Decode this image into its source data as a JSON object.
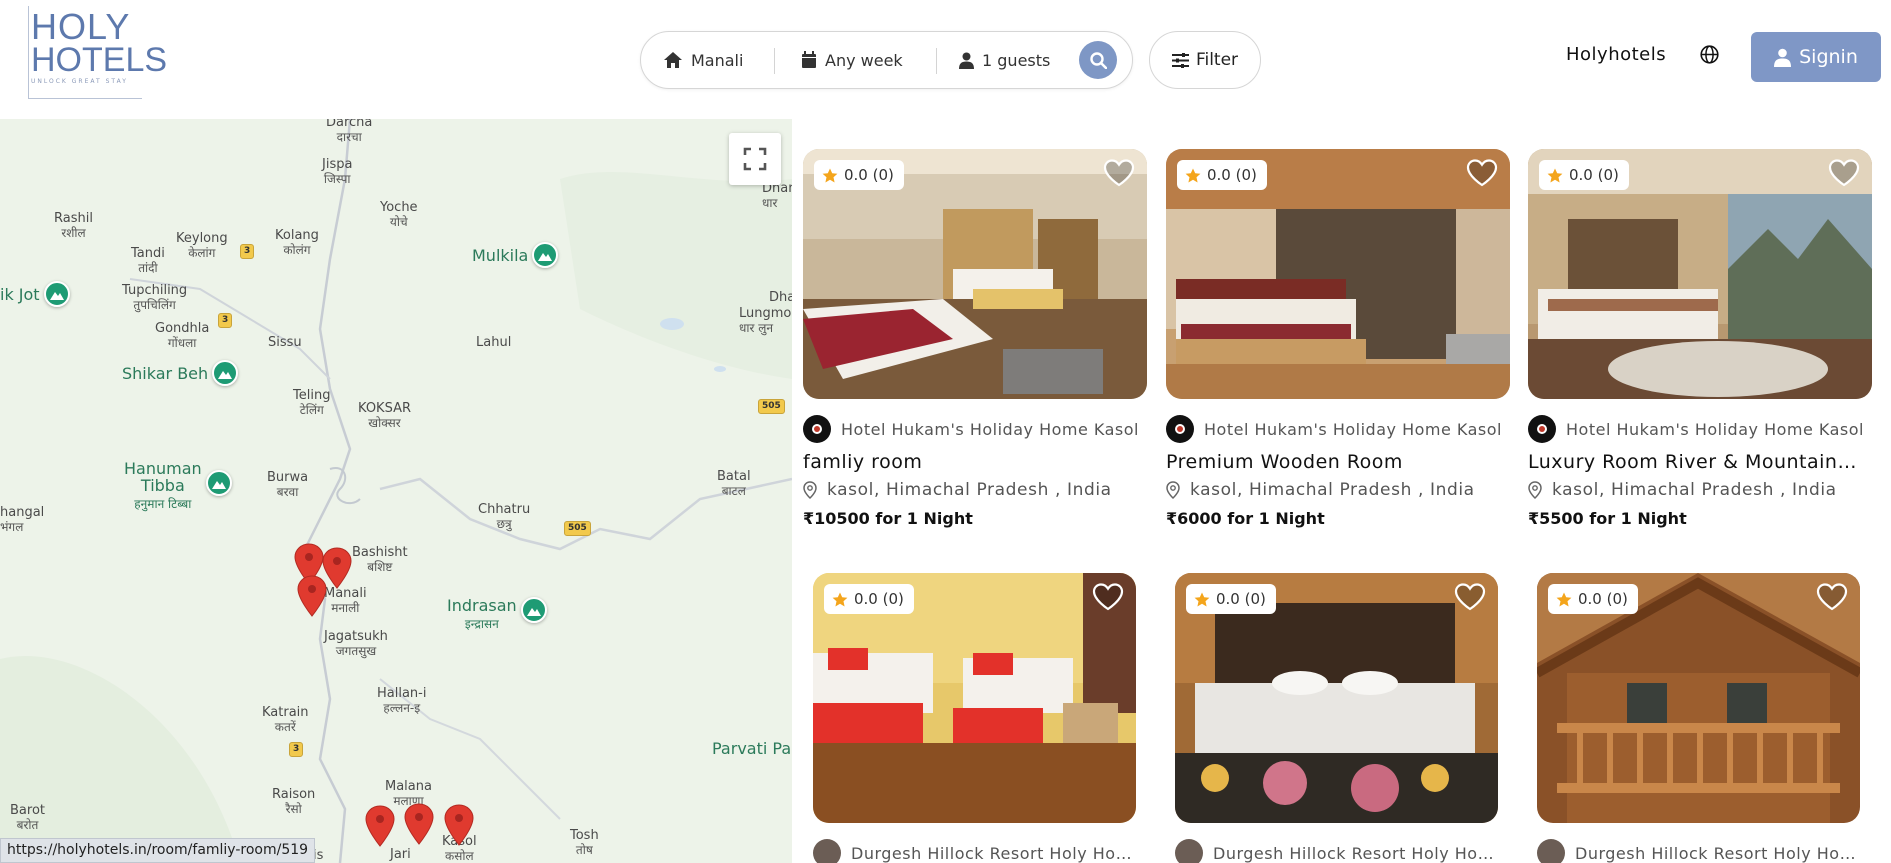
{
  "logo": {
    "line1": "HOLY",
    "line2": "HOTELS",
    "tagline": "UNLOCK GREAT STAY"
  },
  "search": {
    "location": "Manali",
    "dates": "Any week",
    "guests": "1 guests",
    "location_icon": "home-icon",
    "dates_icon": "calendar-icon",
    "guests_icon": "user-icon"
  },
  "filter_label": "Filter",
  "nav": {
    "brand_link": "Holyhotels",
    "signin_label": "Signin"
  },
  "colors": {
    "accent": "#7f97c6",
    "pin": "#e03a2f",
    "poi": "#1e9b74"
  },
  "map": {
    "places": [
      {
        "name": "Darcha",
        "hi": "दारचा"
      },
      {
        "name": "Jispa",
        "hi": "जिस्पा"
      },
      {
        "name": "Yoche",
        "hi": "योचे"
      },
      {
        "name": "Rashil",
        "hi": "रशील"
      },
      {
        "name": "Keylong",
        "hi": "केलांग"
      },
      {
        "name": "Kolang",
        "hi": "कोलंग"
      },
      {
        "name": "Tandi",
        "hi": "तांदी"
      },
      {
        "name": "Tupchiling",
        "hi": "तुपचिलिंग"
      },
      {
        "name": "Gondhla",
        "hi": "गोंधला"
      },
      {
        "name": "Sissu",
        "hi": ""
      },
      {
        "name": "Lahul",
        "hi": ""
      },
      {
        "name": "Teling",
        "hi": "टेलिंग"
      },
      {
        "name": "KOKSAR",
        "hi": "खोक्सर"
      },
      {
        "name": "Burwa",
        "hi": "बरवा"
      },
      {
        "name": "Chhatru",
        "hi": "छत्रु"
      },
      {
        "name": "Batal",
        "hi": "बाटल"
      },
      {
        "name": "hangal",
        "hi": "भंगल"
      },
      {
        "name": "Bashisht",
        "hi": "बशिष्ट"
      },
      {
        "name": "Manali",
        "hi": "मनाली"
      },
      {
        "name": "Jagatsukh",
        "hi": "जगतसुख"
      },
      {
        "name": "Hallan-i",
        "hi": "हल्लन-इ"
      },
      {
        "name": "Katrain",
        "hi": "कतरें"
      },
      {
        "name": "Raison",
        "hi": "रैसो"
      },
      {
        "name": "Malana",
        "hi": "मलाणा"
      },
      {
        "name": "Barot",
        "hi": "बरोत"
      },
      {
        "name": "Tosh",
        "hi": "तोष"
      },
      {
        "name": "Jari",
        "hi": ""
      },
      {
        "name": "Kasol",
        "hi": "कसोल"
      },
      {
        "name": "Dhar",
        "hi": "धार"
      },
      {
        "name": "Dha",
        "hi": ""
      },
      {
        "name": "Lungmo",
        "hi": "धार लुन"
      },
      {
        "name": "ais",
        "hi": ""
      }
    ],
    "pois": [
      {
        "name": "Mulkila",
        "sub": ""
      },
      {
        "name": "ik Jot",
        "sub": ""
      },
      {
        "name": "Shikar Beh",
        "sub": ""
      },
      {
        "name": "Hanuman Tibba",
        "name1": "Hanuman",
        "name2": "Tibba",
        "sub": "हनुमान टिब्बा"
      },
      {
        "name": "Indrasan",
        "sub": "इन्द्रासन"
      },
      {
        "name": "Parvati Pa",
        "sub": ""
      }
    ],
    "roads": [
      "3",
      "3",
      "505",
      "505",
      "3"
    ],
    "fullscreen_icon": "fullscreen-icon"
  },
  "status_url": "https://holyhotels.in/room/famliy-room/519",
  "listings": [
    {
      "rating": "0.0 (0)",
      "host": "Hotel Hukam's Holiday Home Kasol",
      "title": "famliy room",
      "location": "kasol, Himachal Pradesh , India",
      "price": "₹10500 for 1 Night"
    },
    {
      "rating": "0.0 (0)",
      "host": "Hotel Hukam's Holiday Home Kasol",
      "title": "Premium Wooden Room",
      "location": "kasol, Himachal Pradesh , India",
      "price": "₹6000 for 1 Night"
    },
    {
      "rating": "0.0 (0)",
      "host": "Hotel Hukam's Holiday Home Kasol",
      "title": "Luxury Room River & Mountain View",
      "location": "kasol, Himachal Pradesh , India",
      "price": "₹5500 for 1 Night"
    },
    {
      "rating": "0.0 (0)",
      "host": "Durgesh Hillock Resort Holy Hotels",
      "title": "",
      "location": "",
      "price": ""
    },
    {
      "rating": "0.0 (0)",
      "host": "Durgesh Hillock Resort Holy Hotels",
      "title": "",
      "location": "",
      "price": ""
    },
    {
      "rating": "0.0 (0)",
      "host": "Durgesh Hillock Resort Holy Hotels",
      "title": "",
      "location": "",
      "price": ""
    }
  ]
}
